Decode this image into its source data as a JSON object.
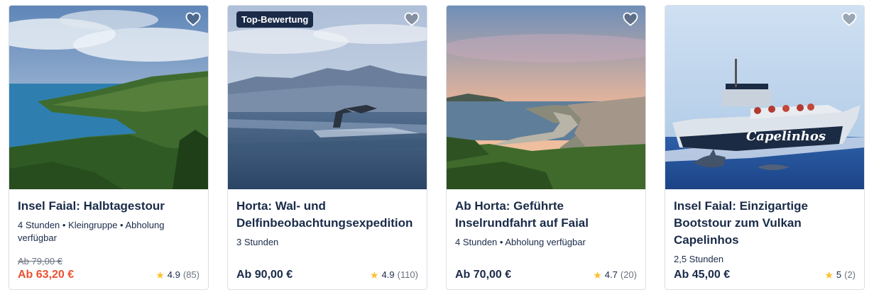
{
  "cards": [
    {
      "title": "Insel Faial: Halbtagestour",
      "details": "4 Stunden • Kleingruppe • Abholung verfügbar",
      "price_old": "Ab 79,00 €",
      "price": "Ab 63,20 €",
      "rating": "4.9",
      "rating_count": "(85)",
      "image": "coastal-cliffs-landscape"
    },
    {
      "badge": "Top-Bewertung",
      "title": "Horta: Wal- und Delfinbeobachtungsexpedition",
      "details": "3 Stunden",
      "price": "Ab 90,00 €",
      "rating": "4.9",
      "rating_count": "(110)",
      "image": "whale-tail-ocean"
    },
    {
      "title": "Ab Horta: Geführte Inselrundfahrt auf Faial",
      "details": "4 Stunden • Abholung verfügbar",
      "price": "Ab 70,00 €",
      "rating": "4.7",
      "rating_count": "(20)",
      "image": "harbor-town-sunset"
    },
    {
      "title": "Insel Faial: Einzigartige Bootstour zum Vulkan Capelinhos",
      "details": "2,5 Stunden",
      "price": "Ab 45,00 €",
      "rating": "5",
      "rating_count": "(2)",
      "image": "speedboat-dolphins",
      "boat_name": "Capelinhos"
    }
  ],
  "icons": {
    "wishlist": "heart-icon",
    "rating": "star-icon"
  },
  "colors": {
    "sale": "#eb5130",
    "text": "#1a2b49",
    "star": "#fcc12c",
    "badge_bg": "#1a2b49"
  }
}
